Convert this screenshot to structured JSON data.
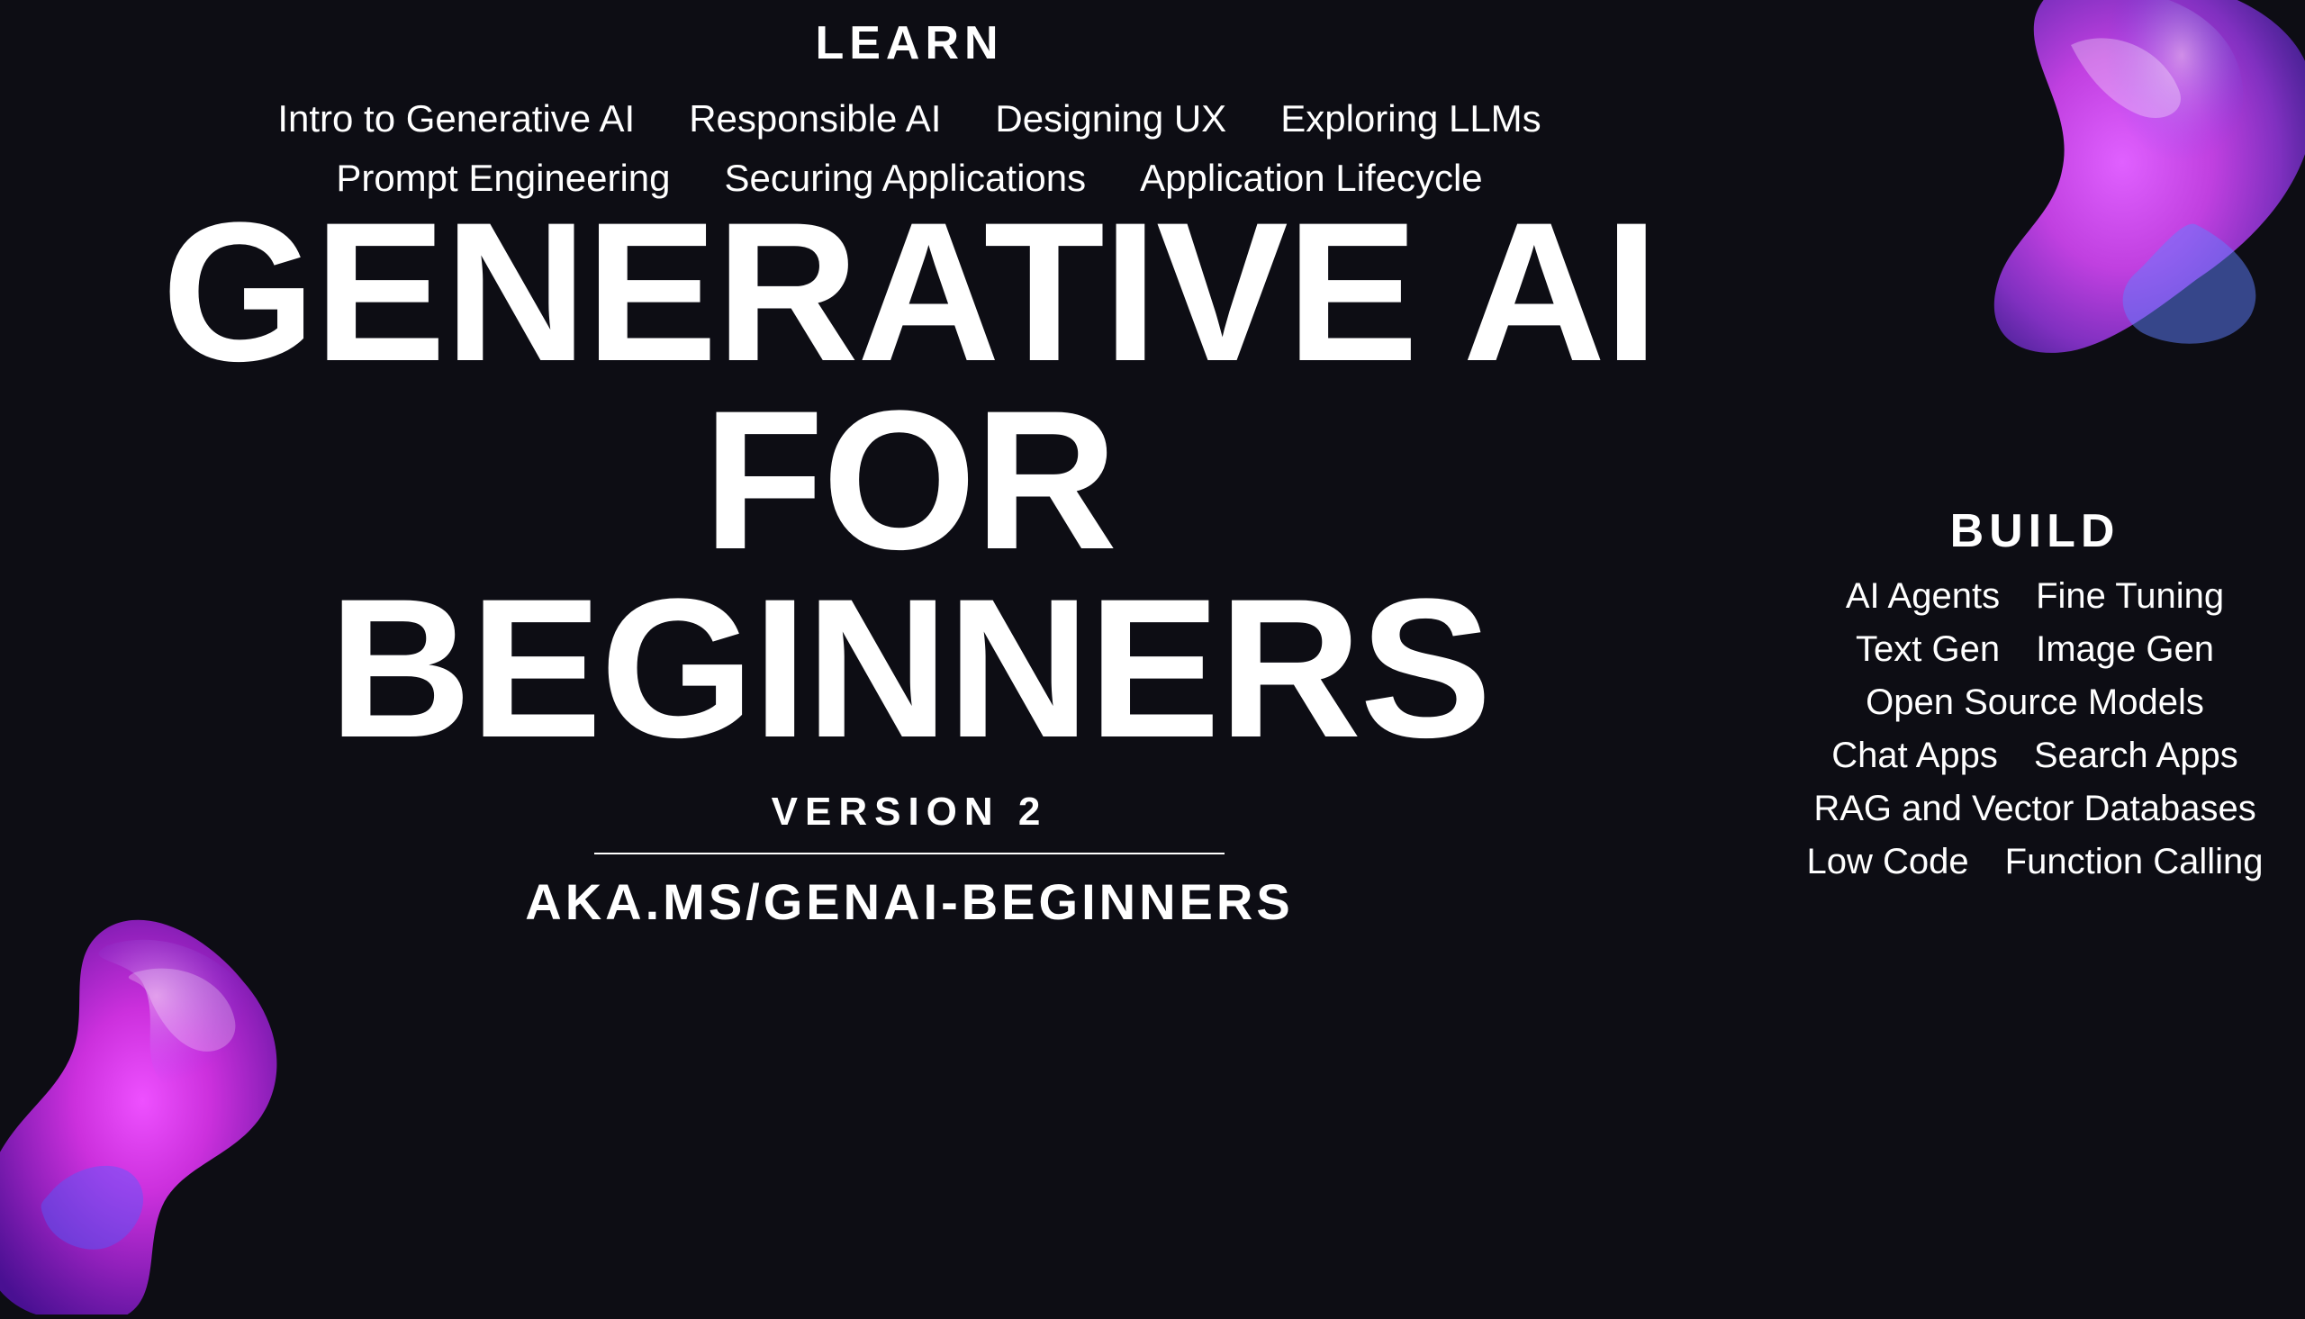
{
  "learn": {
    "label": "LEARN",
    "row1": [
      "Intro to Generative AI",
      "Responsible AI",
      "Designing UX",
      "Exploring LLMs"
    ],
    "row2": [
      "Prompt Engineering",
      "Securing Applications",
      "Application Lifecycle"
    ]
  },
  "main_title": {
    "line1": "GENERATIVE AI",
    "line2": "FOR",
    "line3": "BEGINNERS",
    "version": "VERSION 2",
    "url": "AKA.MS/GENAI-BEGINNERS"
  },
  "build": {
    "label": "BUILD",
    "rows": [
      [
        "AI Agents",
        "Fine Tuning"
      ],
      [
        "Text Gen",
        "Image Gen"
      ],
      [
        "Open Source Models"
      ],
      [
        "Chat Apps",
        "Search Apps"
      ],
      [
        "RAG and Vector Databases"
      ],
      [
        "Low Code",
        "Function Calling"
      ]
    ]
  },
  "colors": {
    "background": "#0d0d14",
    "text": "#ffffff",
    "accent_purple": "#c060ff",
    "accent_pink": "#ff40cc",
    "accent_blue": "#4040ff"
  }
}
